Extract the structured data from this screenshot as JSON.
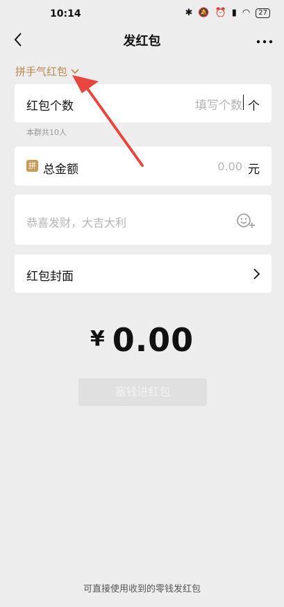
{
  "status_bar": {
    "time": "10:14",
    "battery": "27"
  },
  "nav": {
    "title": "发红包"
  },
  "type_switch": {
    "label": "拼手气红包"
  },
  "count": {
    "label": "红包个数",
    "placeholder": "填写个数",
    "unit": "个",
    "hint": "本群共10人"
  },
  "amount": {
    "badge": "拼",
    "label": "总金额",
    "placeholder": "0.00",
    "unit": "元"
  },
  "greeting": {
    "placeholder": "恭喜发财，大吉大利"
  },
  "cover": {
    "label": "红包封面"
  },
  "total": {
    "currency": "¥",
    "value": "0.00"
  },
  "submit": {
    "label": "塞钱进红包"
  },
  "footer": {
    "note": "可直接使用收到的零钱发红包"
  },
  "colors": {
    "accent": "#b8894a",
    "arrow": "#e8463c",
    "background": "#ededed"
  },
  "icons": [
    "back-arrow-icon",
    "more-dots-icon",
    "chevron-down-icon",
    "emoji-add-icon",
    "chevron-right-icon"
  ]
}
